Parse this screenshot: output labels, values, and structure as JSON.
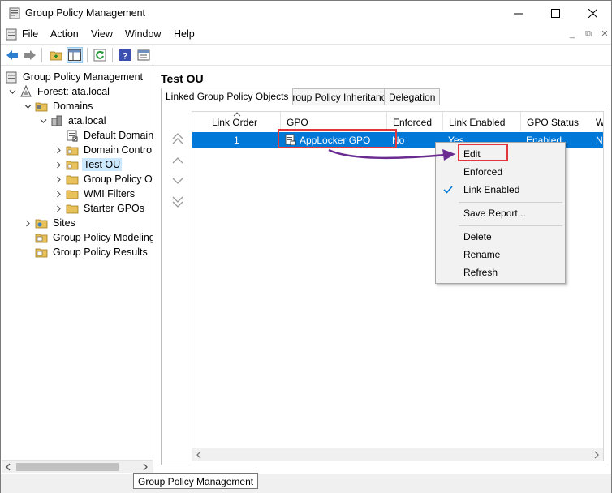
{
  "window": {
    "title": "Group Policy Management",
    "icon": "gpm-app-icon"
  },
  "menu": {
    "items": [
      "File",
      "Action",
      "View",
      "Window",
      "Help"
    ]
  },
  "toolbar": {
    "buttons": [
      "back-arrow-icon",
      "forward-arrow-icon",
      "folder-up-icon",
      "show-hide-tree-icon",
      "refresh-icon",
      "help-icon",
      "properties-icon"
    ]
  },
  "tree": {
    "root": "Group Policy Management",
    "forest": "Forest: ata.local",
    "domains": "Domains",
    "domain": "ata.local",
    "children": [
      "Default Domain",
      "Domain Contro",
      "Test OU",
      "Group Policy Ob",
      "WMI Filters",
      "Starter GPOs"
    ],
    "sites": "Sites",
    "modeling": "Group Policy Modeling",
    "results": "Group Policy Results"
  },
  "main": {
    "title": "Test OU",
    "tabs": [
      "Linked Group Policy Objects",
      "Group Policy Inheritance",
      "Delegation"
    ],
    "columns": [
      "Link Order",
      "GPO",
      "Enforced",
      "Link Enabled",
      "GPO Status",
      "W"
    ],
    "rows": [
      {
        "link_order": "1",
        "gpo": "AppLocker GPO",
        "enforced": "No",
        "link_enabled": "Yes",
        "gpo_status": "Enabled",
        "w": "N"
      }
    ]
  },
  "context_menu": {
    "items": [
      "Edit",
      "Enforced",
      "Link Enabled",
      "Save Report...",
      "Delete",
      "Rename",
      "Refresh"
    ]
  },
  "tooltip": "Group Policy Management",
  "colors": {
    "selection": "#0078d7",
    "tree_selection": "#cce8ff",
    "annotation": "#e0363c",
    "arrow": "#6b2c91"
  }
}
